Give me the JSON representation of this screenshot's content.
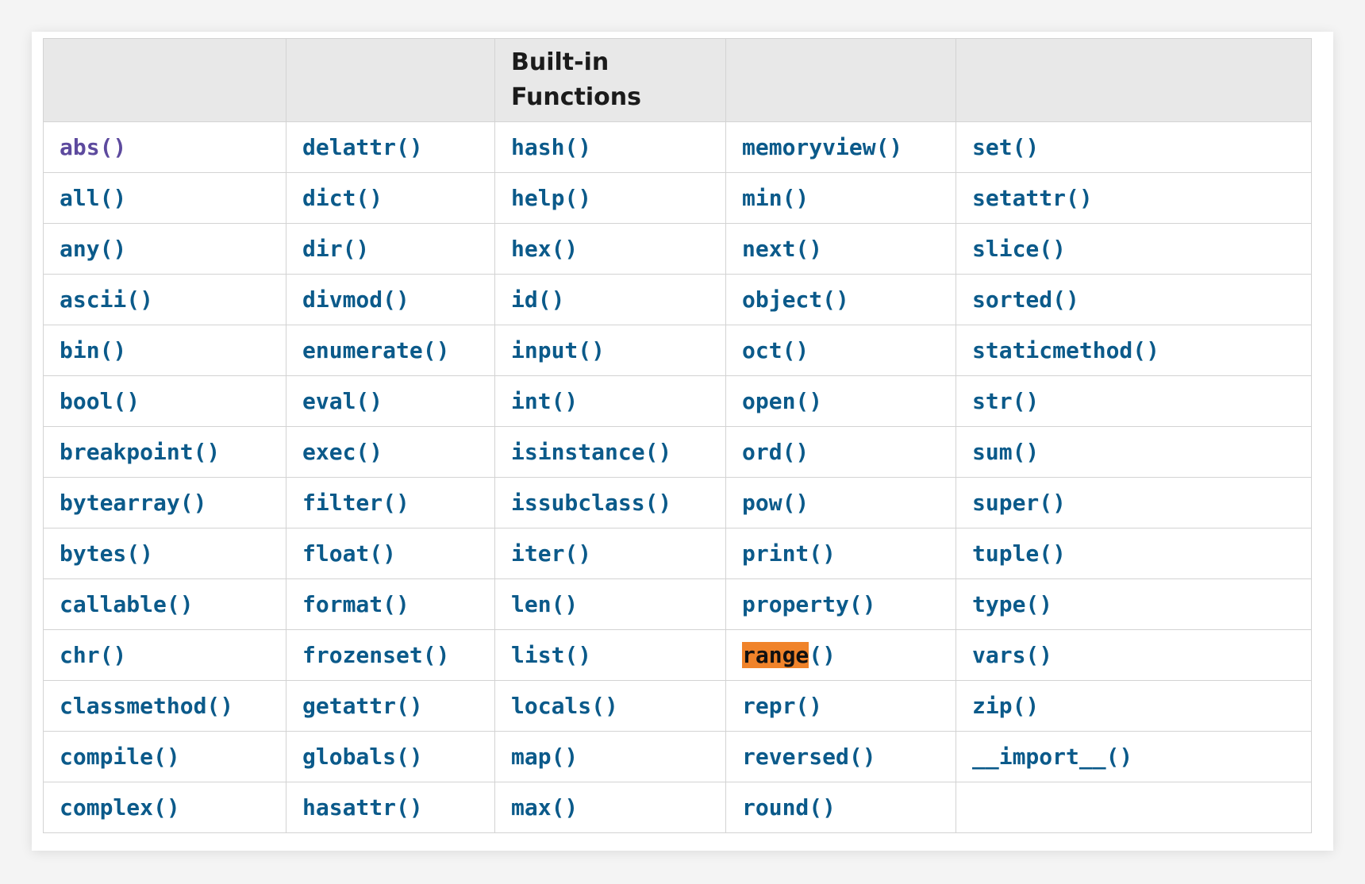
{
  "table": {
    "headers": [
      "",
      "",
      "Built-in Functions",
      "",
      ""
    ],
    "rows": [
      [
        "abs()",
        "delattr()",
        "hash()",
        "memoryview()",
        "set()"
      ],
      [
        "all()",
        "dict()",
        "help()",
        "min()",
        "setattr()"
      ],
      [
        "any()",
        "dir()",
        "hex()",
        "next()",
        "slice()"
      ],
      [
        "ascii()",
        "divmod()",
        "id()",
        "object()",
        "sorted()"
      ],
      [
        "bin()",
        "enumerate()",
        "input()",
        "oct()",
        "staticmethod()"
      ],
      [
        "bool()",
        "eval()",
        "int()",
        "open()",
        "str()"
      ],
      [
        "breakpoint()",
        "exec()",
        "isinstance()",
        "ord()",
        "sum()"
      ],
      [
        "bytearray()",
        "filter()",
        "issubclass()",
        "pow()",
        "super()"
      ],
      [
        "bytes()",
        "float()",
        "iter()",
        "print()",
        "tuple()"
      ],
      [
        "callable()",
        "format()",
        "len()",
        "property()",
        "type()"
      ],
      [
        "chr()",
        "frozenset()",
        "list()",
        "range()",
        "vars()"
      ],
      [
        "classmethod()",
        "getattr()",
        "locals()",
        "repr()",
        "zip()"
      ],
      [
        "compile()",
        "globals()",
        "map()",
        "reversed()",
        "__import__()"
      ],
      [
        "complex()",
        "hasattr()",
        "max()",
        "round()",
        ""
      ]
    ],
    "visited": [
      "abs()"
    ],
    "highlight": {
      "function": "range()",
      "match": "range"
    }
  },
  "colors": {
    "link": "#0b5a8a",
    "visited_link": "#5d4a9e",
    "highlight": "#f0832a",
    "header_bg": "#e8e8e8",
    "border": "#d3d3d3"
  }
}
